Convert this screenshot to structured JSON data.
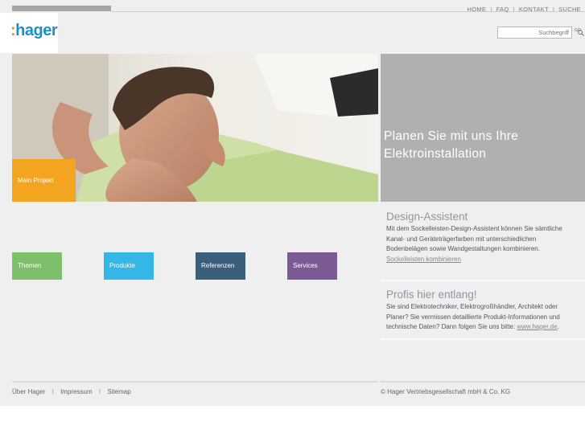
{
  "topnav": {
    "items": [
      "HOME",
      "FAQ",
      "KONTAKT",
      "SUCHE"
    ],
    "separator": "I"
  },
  "logo": {
    "dots": ":",
    "text": "hager"
  },
  "search": {
    "placeholder": "Suchbegriff",
    "icon": "search-go-icon"
  },
  "hero": {
    "headline_line1": "Planen Sie mit uns Ihre",
    "headline_line2": "Elektroinstallation",
    "project_label": "Mein Projekt"
  },
  "tiles": [
    {
      "label": "Themen",
      "color": "#7dbf6a"
    },
    {
      "label": "Produkte",
      "color": "#34b7e6"
    },
    {
      "label": "Referenzen",
      "color": "#3a5f7a"
    },
    {
      "label": "Services",
      "color": "#7c5a96"
    }
  ],
  "design_assistent": {
    "title": "Design-Assistent",
    "text": "Mit dem Sockelleisten-Design-Assistent können Sie sämtliche Kanal- und Geräteträgerfarben mit unterschiedlichen Bodenbelägen sowie Wandgestaltungen kombinieren.",
    "link": "Sockelleisten kombinieren"
  },
  "profis": {
    "title": "Profis hier entlang!",
    "text": "Sie sind Elektrotechniker, Elektrogroßhändler, Architekt oder Planer? Sie vermissen detaillierte Produkt-Informationen und technische Daten? Dann folgen Sie uns bitte: ",
    "link": "www.hager.de",
    "after_link": "."
  },
  "footer": {
    "links": [
      "Über Hager",
      "Impressum",
      "Sitemap"
    ],
    "separator": "I",
    "copyright": "© Hager Vertriebsgesellschaft mbH & Co. KG"
  },
  "colors": {
    "brand_blue": "#1b8fc6",
    "brand_orange": "#f29400",
    "project_orange": "#f4a51f",
    "hero_grey": "#b0b0b0"
  }
}
